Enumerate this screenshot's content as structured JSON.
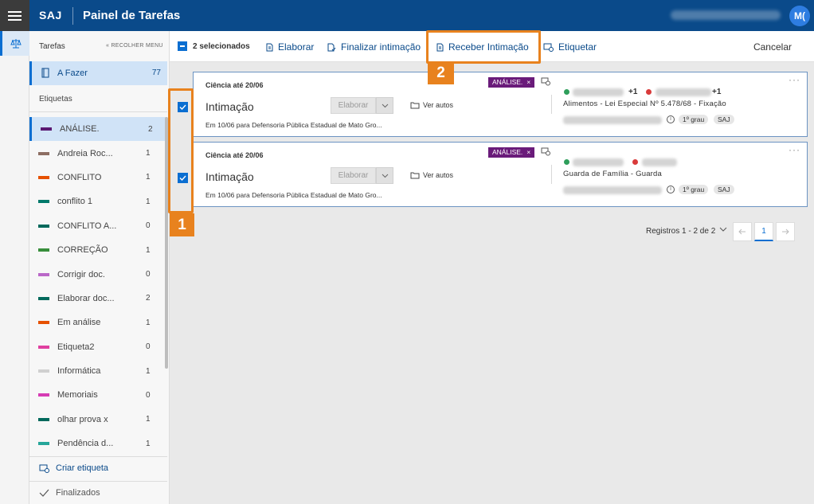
{
  "topbar": {
    "brand": "SAJ",
    "title": "Painel de Tarefas",
    "avatar_initials": "M("
  },
  "sidebar": {
    "tarefas_label": "Tarefas",
    "collapse_label": "« RECOLHER MENU",
    "afazer": {
      "label": "A Fazer",
      "count": "77"
    },
    "etiquetas_title": "Etiquetas",
    "labels": [
      {
        "name": "ANÁLISE.",
        "count": "2",
        "color": "#5b1a72"
      },
      {
        "name": "Andreia Roc...",
        "count": "1",
        "color": "#8d6e63"
      },
      {
        "name": "CONFLITO",
        "count": "1",
        "color": "#e65100"
      },
      {
        "name": "conflito 1",
        "count": "1",
        "color": "#00796b"
      },
      {
        "name": "CONFLITO A...",
        "count": "0",
        "color": "#00695c"
      },
      {
        "name": "CORREÇÃO",
        "count": "1",
        "color": "#388e3c"
      },
      {
        "name": "Corrigir doc.",
        "count": "0",
        "color": "#ba68c8"
      },
      {
        "name": "Elaborar doc...",
        "count": "2",
        "color": "#00695c"
      },
      {
        "name": "Em análise",
        "count": "1",
        "color": "#e65100"
      },
      {
        "name": "Etiqueta2",
        "count": "0",
        "color": "#e040a0"
      },
      {
        "name": "Informática",
        "count": "1",
        "color": "#d0d0d0"
      },
      {
        "name": "Memoriais",
        "count": "0",
        "color": "#d63cb4"
      },
      {
        "name": "olhar prova x",
        "count": "1",
        "color": "#00695c"
      },
      {
        "name": "Pendência d...",
        "count": "1",
        "color": "#26a69a"
      }
    ],
    "criar_etiqueta": "Criar etiqueta",
    "finalizados": "Finalizados"
  },
  "toolbar": {
    "selected": "2 selecionados",
    "elaborar": "Elaborar",
    "finalizar": "Finalizar intimação",
    "receber": "Receber Intimação",
    "etiquetar": "Etiquetar",
    "cancelar": "Cancelar"
  },
  "cards": [
    {
      "ciencia": "Ciência até 20/06",
      "tipo": "Intimação",
      "elaborar": "Elaborar",
      "ver_autos": "Ver autos",
      "desc": "Em 10/06 para Defensoria Pública Estadual de Mato Gro...",
      "tag": "ANÁLISE.",
      "plus1": "+1",
      "plus2": "+1",
      "classe": "Alimentos - Lei Especial Nº 5.478/68 - Fixação",
      "grau": "1º grau",
      "sistema": "SAJ"
    },
    {
      "ciencia": "Ciência até 20/06",
      "tipo": "Intimação",
      "elaborar": "Elaborar",
      "ver_autos": "Ver autos",
      "desc": "Em 10/06 para Defensoria Pública Estadual de Mato Gro...",
      "tag": "ANÁLISE.",
      "classe": "Guarda de Família - Guarda",
      "grau": "1º grau",
      "sistema": "SAJ"
    }
  ],
  "pagination": {
    "text": "Registros 1 - 2 de 2",
    "current_page": "1"
  },
  "callouts": {
    "one": "1",
    "two": "2"
  },
  "colors": {
    "topbar": "#0a4a8a",
    "accent": "#0a6ed1",
    "callout": "#e8821e",
    "tag": "#6a1b7a"
  }
}
